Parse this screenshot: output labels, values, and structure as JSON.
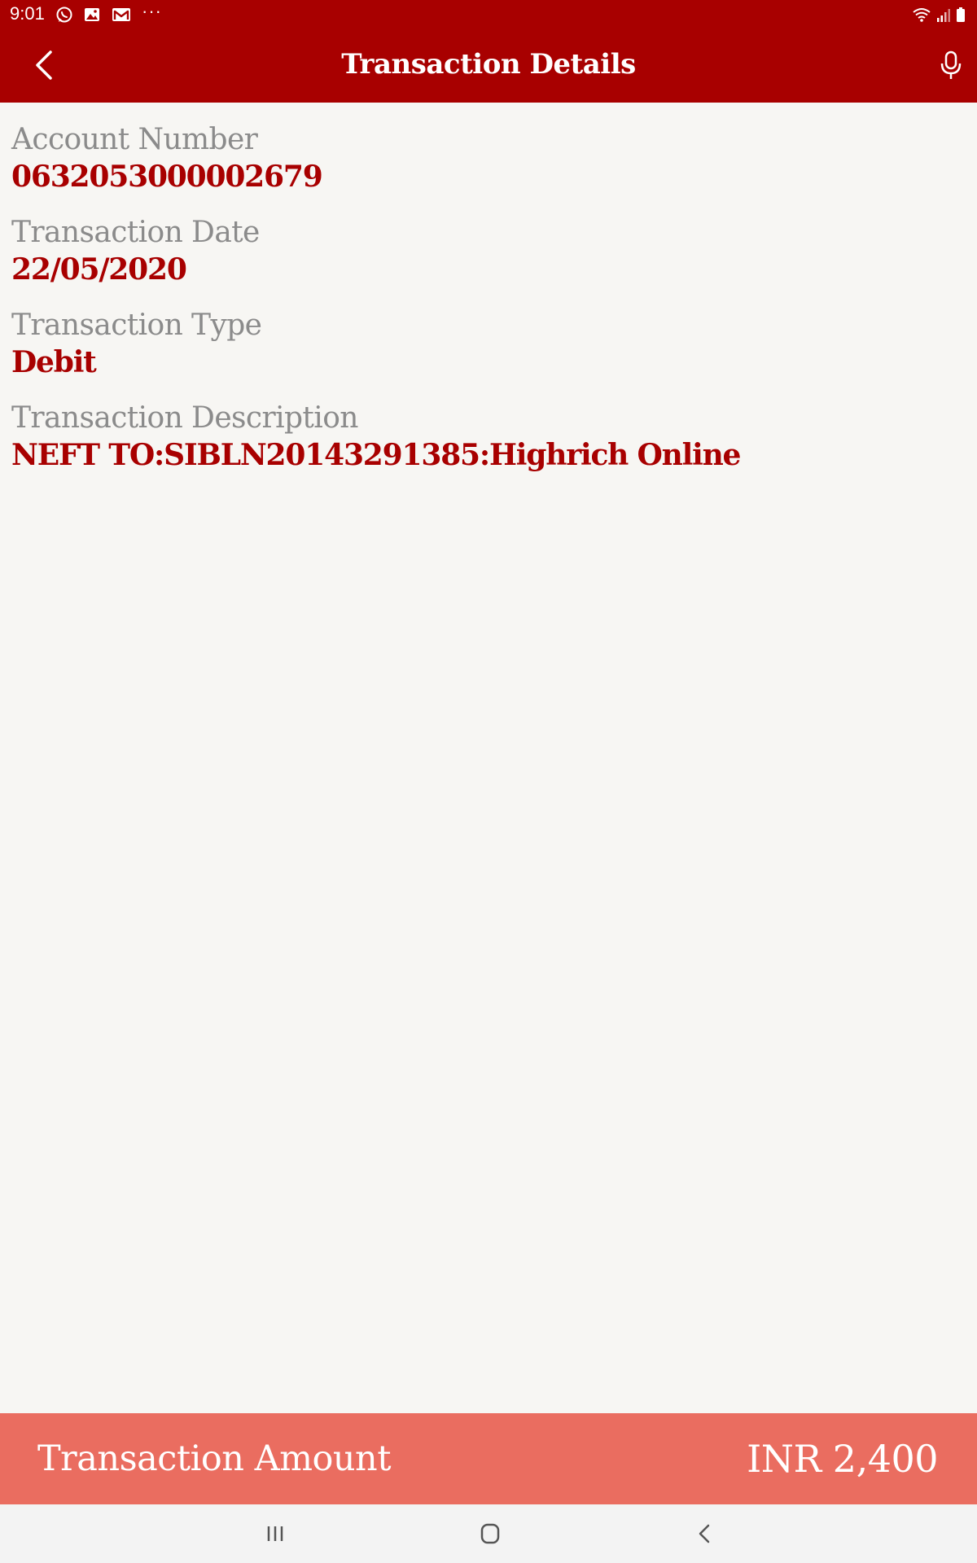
{
  "status_bar": {
    "time": "9:01",
    "left_icons": [
      "whatsapp-icon",
      "gallery-icon",
      "gmail-icon"
    ],
    "more": "···",
    "right_icons": [
      "wifi-icon",
      "signal-icon",
      "battery-icon"
    ]
  },
  "header": {
    "title": "Transaction Details",
    "back_icon": "chevron-left-icon",
    "mic_icon": "microphone-icon"
  },
  "details": {
    "account_number_label": "Account Number",
    "account_number_value": "0632053000002679",
    "date_label": "Transaction Date",
    "date_value": "22/05/2020",
    "type_label": "Transaction Type",
    "type_value": "Debit",
    "description_label": "Transaction Description",
    "description_value": "NEFT TO:SIBLN20143291385:Highrich Online"
  },
  "amount": {
    "label": "Transaction Amount",
    "value": "INR 2,400"
  },
  "nav_bar": {
    "recents_icon": "recents-icon",
    "home_icon": "home-icon",
    "back_icon": "back-icon"
  },
  "colors": {
    "primary": "#a80000",
    "amount_bar": "#ea6d60",
    "label_gray": "#8b8b8b",
    "background": "#f7f6f3"
  }
}
